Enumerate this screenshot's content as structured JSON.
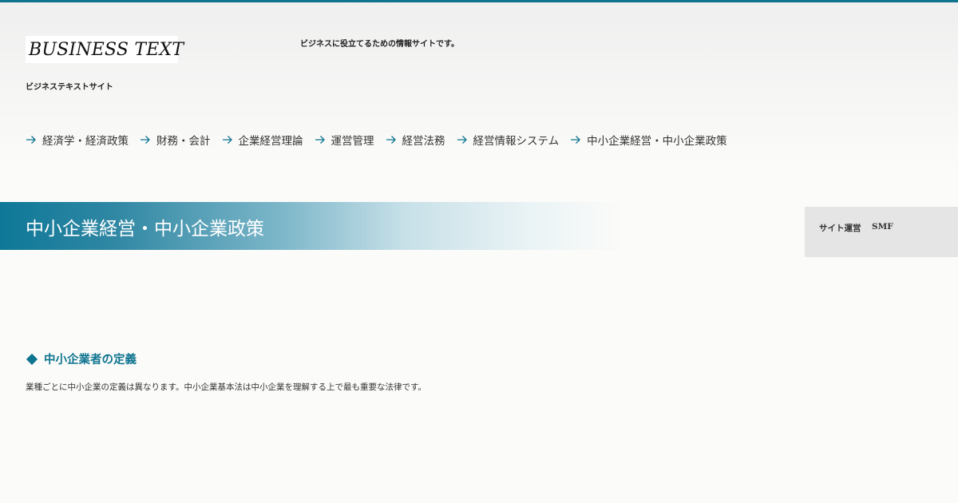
{
  "header": {
    "logo_text": "BUSINESS TEXT",
    "site_name": "ビジネステキストサイト",
    "tagline": "ビジネスに役立てるための情報サイトです。"
  },
  "nav": {
    "arrow_icon": "arrow-right-icon",
    "items": [
      "経済学・経済政策",
      "財務・会計",
      "企業経営理論",
      "運営管理",
      "経営法務",
      "経営情報システム",
      "中小企業経営・中小企業政策"
    ]
  },
  "page": {
    "title": "中小企業経営・中小企業政策"
  },
  "operator": {
    "label": "サイト運営",
    "name": "SMF"
  },
  "section": {
    "heading_icon": "diamond-icon",
    "heading": "中小企業者の定義",
    "body": "業種ごとに中小企業の定義は異なります。中小企業基本法は中小企業を理解する上で最も重要な法律です。"
  },
  "colors": {
    "accent": "#0e7490",
    "operator_bg": "#e5e5e5"
  }
}
